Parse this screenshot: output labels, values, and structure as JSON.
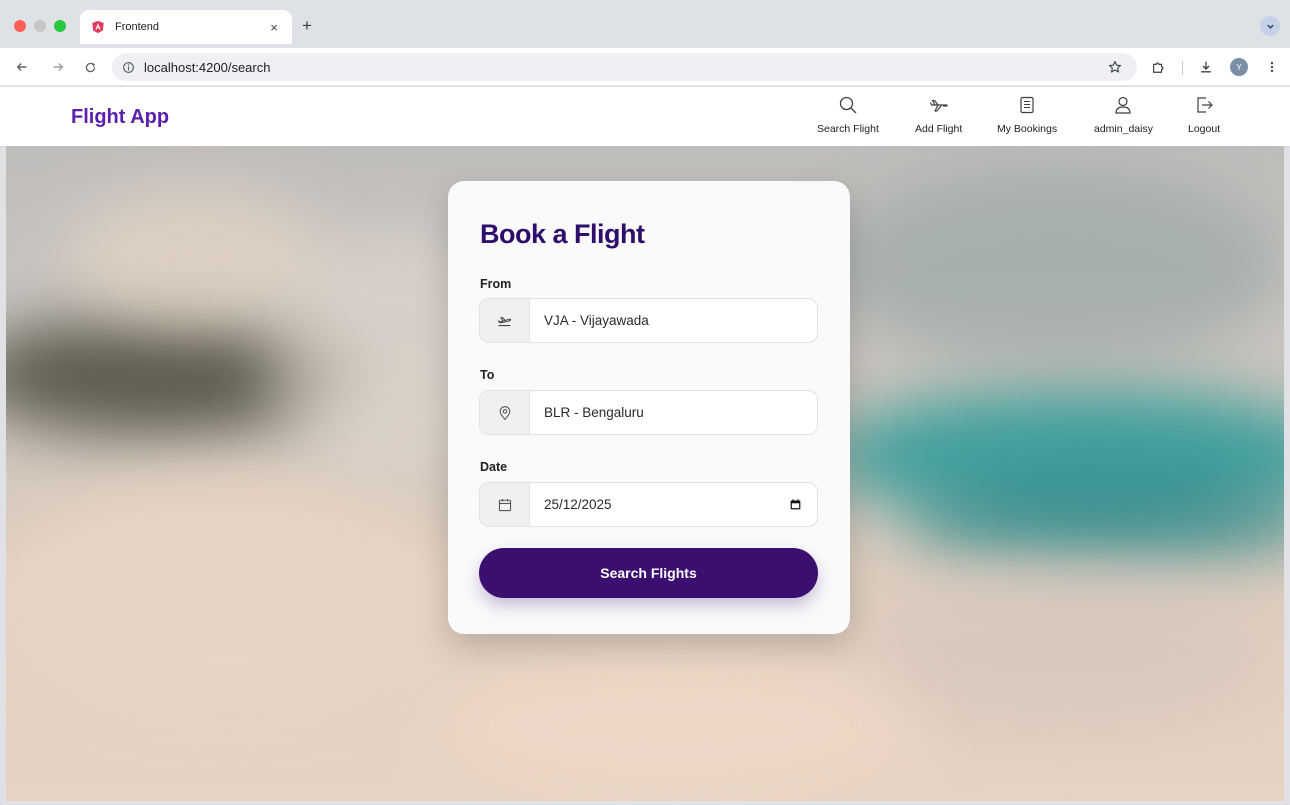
{
  "browser": {
    "tab_title": "Frontend",
    "tab_close": "×",
    "new_tab": "+",
    "url": "localhost:4200/search",
    "profile_initial": "Y"
  },
  "app": {
    "brand": "Flight App",
    "nav": [
      {
        "label": "Search Flight",
        "icon": "search-icon"
      },
      {
        "label": "Add Flight",
        "icon": "plane-icon"
      },
      {
        "label": "My Bookings",
        "icon": "document-icon"
      },
      {
        "label": "admin_daisy",
        "icon": "user-icon"
      },
      {
        "label": "Logout",
        "icon": "logout-icon"
      }
    ]
  },
  "form": {
    "title": "Book a Flight",
    "from": {
      "label": "From",
      "value": "VJA - Vijayawada",
      "icon": "departure-icon"
    },
    "to": {
      "label": "To",
      "value": "BLR - Bengaluru",
      "icon": "location-pin-icon"
    },
    "date": {
      "label": "Date",
      "value": "25/12/2025",
      "icon": "calendar-icon"
    },
    "submit_label": "Search Flights"
  },
  "colors": {
    "brand": "#5a1fae",
    "title": "#2f0f6b",
    "button": "#3a0f6f"
  }
}
